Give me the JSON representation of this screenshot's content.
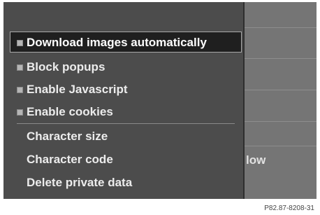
{
  "background": {
    "visible_text": "low"
  },
  "menu": {
    "items": [
      {
        "label": "Download images automatically",
        "checkbox": true,
        "selected": true
      },
      {
        "label": "Block popups",
        "checkbox": true,
        "selected": false
      },
      {
        "label": "Enable Javascript",
        "checkbox": true,
        "selected": false
      },
      {
        "label": "Enable cookies",
        "checkbox": true,
        "selected": false
      },
      {
        "label": "Character size",
        "checkbox": false,
        "selected": false
      },
      {
        "label": "Character code",
        "checkbox": false,
        "selected": false
      },
      {
        "label": "Delete private data",
        "checkbox": false,
        "selected": false
      }
    ]
  },
  "figure_code": "P82.87-8208-31"
}
